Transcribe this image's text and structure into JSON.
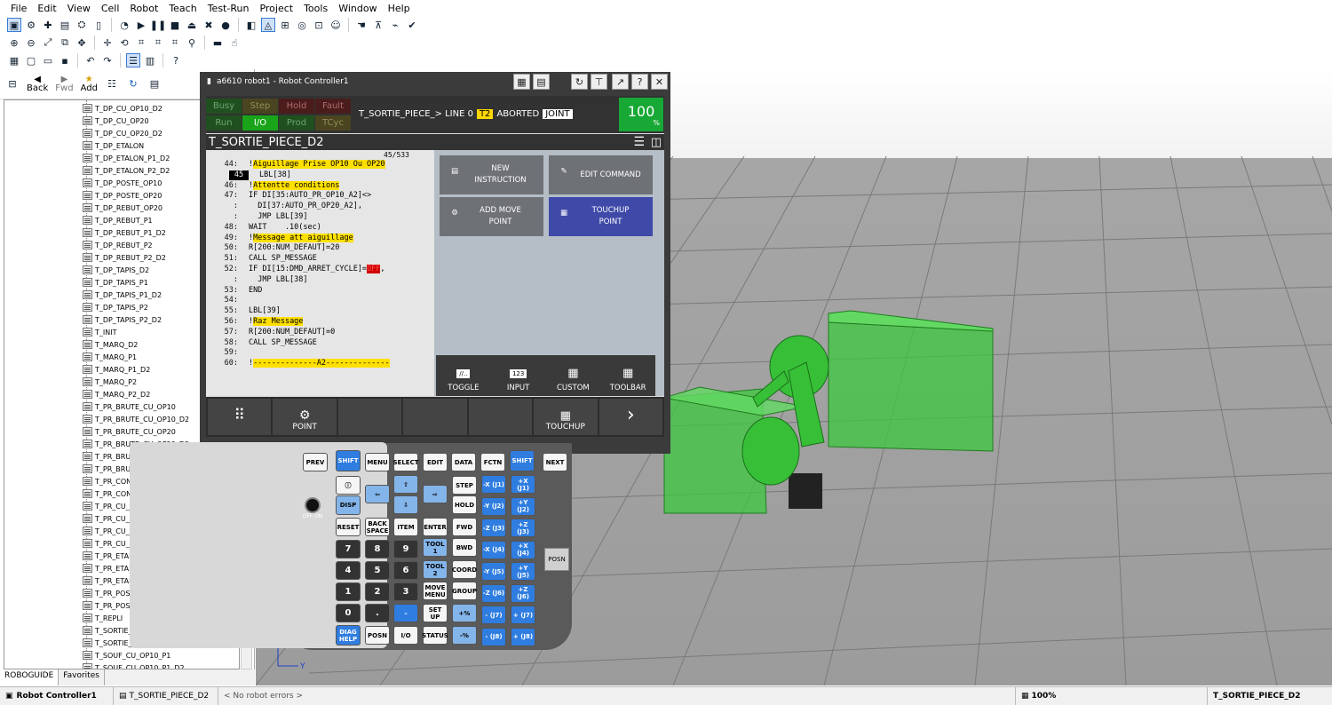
{
  "menu": [
    "File",
    "Edit",
    "View",
    "Cell",
    "Robot",
    "Teach",
    "Test-Run",
    "Project",
    "Tools",
    "Window",
    "Help"
  ],
  "nav": {
    "back": "Back",
    "fwd": "Fwd",
    "add": "Add"
  },
  "tree": [
    "T_DP_CU_OP10_D2",
    "T_DP_CU_OP20",
    "T_DP_CU_OP20_D2",
    "T_DP_ETALON",
    "T_DP_ETALON_P1_D2",
    "T_DP_ETALON_P2_D2",
    "T_DP_POSTE_OP10",
    "T_DP_POSTE_OP20",
    "T_DP_REBUT_OP20",
    "T_DP_REBUT_P1",
    "T_DP_REBUT_P1_D2",
    "T_DP_REBUT_P2",
    "T_DP_REBUT_P2_D2",
    "T_DP_TAPIS_D2",
    "T_DP_TAPIS_P1",
    "T_DP_TAPIS_P1_D2",
    "T_DP_TAPIS_P2",
    "T_DP_TAPIS_P2_D2",
    "T_INIT",
    "T_MARQ_D2",
    "T_MARQ_P1",
    "T_MARQ_P1_D2",
    "T_MARQ_P2",
    "T_MARQ_P2_D2",
    "T_PR_BRUTE_CU_OP10",
    "T_PR_BRUTE_CU_OP10_D2",
    "T_PR_BRUTE_CU_OP20",
    "T_PR_BRUTE_CU_OP20_D2",
    "T_PR_BRUTE_POSTE_OP10",
    "T_PR_BRUTE_POSTE_OP20",
    "T_PR_CONV",
    "T_PR_CONV_D2",
    "T_PR_CU_OP10",
    "T_PR_CU_OP10_D2",
    "T_PR_CU_OP20",
    "T_PR_CU_OP20_D2",
    "T_PR_ETALON",
    "T_PR_ETALON_P1_D2",
    "T_PR_ETALON_P2_D2",
    "T_PR_POSTE_OP10",
    "T_PR_POSTE_OP20",
    "T_REPLI",
    "T_SORTIE_PECE_D1",
    "T_SORTIE_PECE_D2",
    "T_SOUF_CU_OP10_P1",
    "T_SOUF_CU_OP10_P1_D2"
  ],
  "left_tabs": [
    "ROBOGUIDE",
    "Favorites"
  ],
  "status": {
    "controller": "Robot Controller1",
    "program": "T_SORTIE_PIECE_D2",
    "errors": "< No robot errors >",
    "zoom": "100%",
    "program_right": "T_SORTIE_PIECE_D2"
  },
  "pendant": {
    "title": "a6610 robot1 - Robot Controller1",
    "status_labels": [
      "Busy",
      "Step",
      "Hold",
      "Fault",
      "Run",
      "I/O",
      "Prod",
      "TCyc"
    ],
    "prog_line": "T_SORTIE_PIECE_> LINE 0",
    "t2": "T2",
    "aborted": "ABORTED",
    "joint": "JOINT",
    "override": "100",
    "override_unit": "%",
    "prog_title": "T_SORTIE_PIECE_D2",
    "line_count": "45/533",
    "code": [
      {
        "n": "44:",
        "pre": "!",
        "hl": "Aiguillage Prise OP10 Ou OP20",
        "post": ""
      },
      {
        "n": "45",
        "pre": "LBL[38]",
        "hl": "",
        "post": ""
      },
      {
        "n": "46:",
        "pre": "!",
        "hl": "Attentte conditions",
        "post": ""
      },
      {
        "n": "47:",
        "pre": "IF DI[35:AUTO_PR_OP10_A2]<>",
        "hl": "",
        "post": ""
      },
      {
        "n": ":",
        "pre": "  DI[37:AUTO_PR_OP20_A2],",
        "hl": "",
        "post": ""
      },
      {
        "n": ":",
        "pre": "  JMP LBL[39]",
        "hl": "",
        "post": ""
      },
      {
        "n": "48:",
        "pre": "WAIT    .10(sec)",
        "hl": "",
        "post": ""
      },
      {
        "n": "49:",
        "pre": "!",
        "hl": "Message att aiguillage",
        "post": ""
      },
      {
        "n": "50:",
        "pre": "R[200:NUM_DEFAUT]=20",
        "hl": "",
        "post": ""
      },
      {
        "n": "51:",
        "pre": "CALL SP_MESSAGE",
        "hl": "",
        "post": ""
      },
      {
        "n": "52:",
        "pre": "IF DI[15:DMD_ARRET_CYCLE]=",
        "hl": "",
        "red": "OFF",
        "post": ","
      },
      {
        "n": ":",
        "pre": "  JMP LBL[38]",
        "hl": "",
        "post": ""
      },
      {
        "n": "53:",
        "pre": "END",
        "hl": "",
        "post": ""
      },
      {
        "n": "54:",
        "pre": "",
        "hl": "",
        "post": ""
      },
      {
        "n": "55:",
        "pre": "LBL[39]",
        "hl": "",
        "post": ""
      },
      {
        "n": "56:",
        "pre": "!",
        "hl": "Raz Message",
        "post": ""
      },
      {
        "n": "57:",
        "pre": "R[200:NUM_DEFAUT]=0",
        "hl": "",
        "post": ""
      },
      {
        "n": "58:",
        "pre": "CALL SP_MESSAGE",
        "hl": "",
        "post": ""
      },
      {
        "n": "59:",
        "pre": "",
        "hl": "",
        "post": ""
      },
      {
        "n": "60:",
        "pre": "!",
        "hl": "--------------A2--------------",
        "post": ""
      }
    ],
    "buttons": {
      "new": "NEW INSTRUCTION",
      "edit": "EDIT COMMAND",
      "add": "ADD MOVE POINT",
      "touchup": "TOUCHUP POINT"
    },
    "bottom": [
      "TOGGLE",
      "INPUT",
      "CUSTOM",
      "TOOLBAR"
    ],
    "bottom_icons": [
      "//..",
      "123",
      "",
      ""
    ],
    "fkeys": [
      "",
      "POINT",
      "",
      "",
      "",
      "TOUCHUP",
      ""
    ]
  },
  "keys": {
    "prev": "PREV",
    "shift": "SHIFT",
    "menu": "MENU",
    "select": "SELECT",
    "edit": "EDIT",
    "data": "DATA",
    "fctn": "FCTN",
    "next": "NEXT",
    "disp": "DISP",
    "reset": "RESET",
    "backspace": "BACK SPACE",
    "item": "ITEM",
    "enter": "ENTER",
    "step": "STEP",
    "hold": "HOLD",
    "fwd": "FWD",
    "bwd": "BWD",
    "coord": "COORD",
    "group": "GROUP",
    "tool1": "TOOL 1",
    "tool2": "TOOL 2",
    "movemenu": "MOVE MENU",
    "setup": "SET UP",
    "status": "STATUS",
    "diag": "DIAG HELP",
    "posn": "POSN",
    "io": "I/O",
    "off": "OFF",
    "on": "ON",
    "posn_side": "POSN",
    "jog": [
      "-X (J1)",
      "+X (J1)",
      "-Y (J2)",
      "+Y (J2)",
      "-Z (J3)",
      "+Z (J3)",
      "-X (J4)",
      "+X (J4)",
      "-Y (J5)",
      "+Y (J5)",
      "-Z (J6)",
      "+Z (J6)",
      "- (J7)",
      "+ (J7)",
      "- (J8)",
      "+ (J8)"
    ],
    "digits": [
      "7",
      "8",
      "9",
      "4",
      "5",
      "6",
      "1",
      "2",
      "3",
      "0",
      "."
    ],
    "pct_up": "+%",
    "pct_dn": "-%"
  },
  "axes": {
    "z": "Z",
    "y": "Y"
  },
  "colors": {
    "green_fixture": "#3ec83e",
    "override_green": "#17a835",
    "highlight": "#ffe000",
    "blue_key": "#2f7de0"
  }
}
